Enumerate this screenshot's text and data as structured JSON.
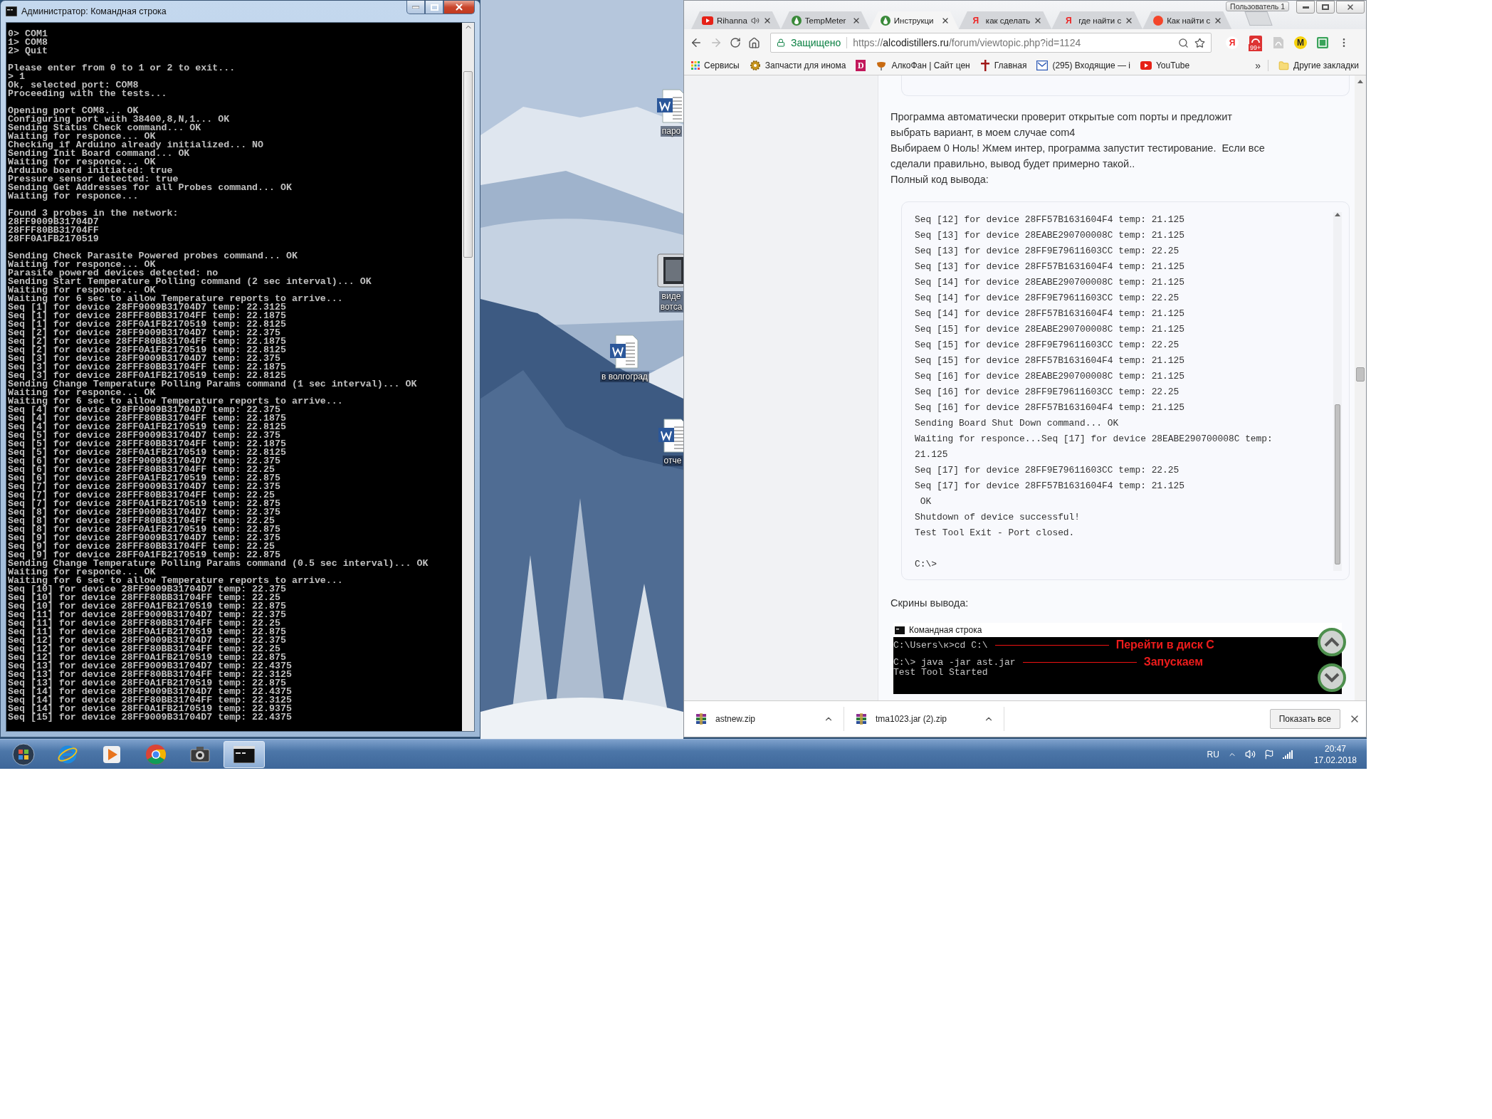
{
  "console_window": {
    "title": "Администратор: Командная строка",
    "blocks": [
      [
        "0> COM1",
        "1> COM8",
        "2> Quit"
      ],
      [
        "Please enter from 0 to 1 or 2 to exit...",
        "> 1",
        "Ok, selected port: COM8",
        "Proceeding with the tests..."
      ],
      [
        "Opening port COM8... OK",
        "Configuring port with 38400,8,N,1... OK",
        "Sending Status Check command... OK",
        "Waiting for responce... OK",
        "Checking if Arduino already initialized... NO",
        "Sending Init Board command... OK",
        "Waiting for responce... OK",
        "Arduino board initiated: true",
        "Pressure sensor detected: true",
        "Sending Get Addresses for all Probes command... OK",
        "Waiting for responce..."
      ],
      [
        "Found 3 probes in the network:",
        "28FF9009B31704D7",
        "28FFF80BB31704FF",
        "28FF0A1FB2170519"
      ],
      [
        "Sending Check Parasite Powered probes command... OK",
        "Waiting for responce... OK",
        "Parasite powered devices detected: no",
        "Sending Start Temperature Polling command (2 sec interval)... OK",
        "Waiting for responce... OK",
        "Waiting for 6 sec to allow Temperature reports to arrive...",
        "Seq [1] for device 28FF9009B31704D7 temp: 22.3125",
        "Seq [1] for device 28FFF80BB31704FF temp: 22.1875",
        "Seq [1] for device 28FF0A1FB2170519 temp: 22.8125",
        "Seq [2] for device 28FF9009B31704D7 temp: 22.375",
        "Seq [2] for device 28FFF80BB31704FF temp: 22.1875",
        "Seq [2] for device 28FF0A1FB2170519 temp: 22.8125",
        "Seq [3] for device 28FF9009B31704D7 temp: 22.375",
        "Seq [3] for device 28FFF80BB31704FF temp: 22.1875",
        "Seq [3] for device 28FF0A1FB2170519 temp: 22.8125",
        "Sending Change Temperature Polling Params command (1 sec interval)... OK",
        "Waiting for responce... OK",
        "Waiting for 6 sec to allow Temperature reports to arrive...",
        "Seq [4] for device 28FF9009B31704D7 temp: 22.375",
        "Seq [4] for device 28FFF80BB31704FF temp: 22.1875",
        "Seq [4] for device 28FF0A1FB2170519 temp: 22.8125",
        "Seq [5] for device 28FF9009B31704D7 temp: 22.375",
        "Seq [5] for device 28FFF80BB31704FF temp: 22.1875",
        "Seq [5] for device 28FF0A1FB2170519 temp: 22.8125",
        "Seq [6] for device 28FF9009B31704D7 temp: 22.375",
        "Seq [6] for device 28FFF80BB31704FF temp: 22.25",
        "Seq [6] for device 28FF0A1FB2170519 temp: 22.875",
        "Seq [7] for device 28FF9009B31704D7 temp: 22.375",
        "Seq [7] for device 28FFF80BB31704FF temp: 22.25",
        "Seq [7] for device 28FF0A1FB2170519 temp: 22.875",
        "Seq [8] for device 28FF9009B31704D7 temp: 22.375",
        "Seq [8] for device 28FFF80BB31704FF temp: 22.25",
        "Seq [8] for device 28FF0A1FB2170519 temp: 22.875",
        "Seq [9] for device 28FF9009B31704D7 temp: 22.375",
        "Seq [9] for device 28FFF80BB31704FF temp: 22.25",
        "Seq [9] for device 28FF0A1FB2170519 temp: 22.875",
        "Sending Change Temperature Polling Params command (0.5 sec interval)... OK",
        "Waiting for responce... OK",
        "Waiting for 6 sec to allow Temperature reports to arrive...",
        "Seq [10] for device 28FF9009B31704D7 temp: 22.375",
        "Seq [10] for device 28FFF80BB31704FF temp: 22.25",
        "Seq [10] for device 28FF0A1FB2170519 temp: 22.875",
        "Seq [11] for device 28FF9009B31704D7 temp: 22.375",
        "Seq [11] for device 28FFF80BB31704FF temp: 22.25",
        "Seq [11] for device 28FF0A1FB2170519 temp: 22.875",
        "Seq [12] for device 28FF9009B31704D7 temp: 22.375",
        "Seq [12] for device 28FFF80BB31704FF temp: 22.25",
        "Seq [12] for device 28FF0A1FB2170519 temp: 22.875",
        "Seq [13] for device 28FF9009B31704D7 temp: 22.4375",
        "Seq [13] for device 28FFF80BB31704FF temp: 22.3125",
        "Seq [13] for device 28FF0A1FB2170519 temp: 22.875",
        "Seq [14] for device 28FF9009B31704D7 temp: 22.4375",
        "Seq [14] for device 28FFF80BB31704FF temp: 22.3125",
        "Seq [14] for device 28FF0A1FB2170519 temp: 22.9375",
        "Seq [15] for device 28FF9009B31704D7 temp: 22.4375"
      ]
    ]
  },
  "desktop": {
    "icons": [
      {
        "kind": "document",
        "label_lines": [
          "паро"
        ]
      },
      {
        "kind": "video",
        "label_lines": [
          "виде",
          "вотса"
        ]
      },
      {
        "kind": "document",
        "label_lines": [
          "в волгоград"
        ]
      },
      {
        "kind": "document",
        "label_lines": [
          "отче"
        ]
      }
    ]
  },
  "browser": {
    "profile_button": "Пользователь 1",
    "tabs": [
      {
        "kind": "play",
        "title": "Rihanna",
        "audio": true,
        "selected": false
      },
      {
        "kind": "drop",
        "title": "TempMeter",
        "audio": false,
        "selected": false
      },
      {
        "kind": "drop",
        "title": "Инструкци",
        "audio": false,
        "selected": true
      },
      {
        "kind": "letter",
        "glyph": "Я",
        "title": "как сделать",
        "audio": false,
        "selected": false
      },
      {
        "kind": "letter",
        "glyph": "Я",
        "title": "где найти с",
        "audio": false,
        "selected": false
      },
      {
        "kind": "dot",
        "title": "Как найти с",
        "audio": false,
        "selected": false
      }
    ],
    "security_label": "Защищено",
    "url": {
      "scheme": "https://",
      "host": "alcodistillers.ru",
      "path": "/forum/viewtopic.php?id=1124"
    },
    "extensions": [
      {
        "kind": "letter",
        "glyph": "Я"
      },
      {
        "kind": "badge",
        "badge": "99+"
      },
      {
        "kind": "file"
      },
      {
        "kind": "coin",
        "glyph": "M"
      },
      {
        "kind": "shield"
      }
    ],
    "bookmarks": [
      {
        "kind": "apps",
        "label": "Сервисы"
      },
      {
        "kind": "gear",
        "label": "Запчасти для инома"
      },
      {
        "kind": "tile",
        "glyph": "D"
      },
      {
        "kind": "glass",
        "label": "АлкоФан | Сайт цен"
      },
      {
        "kind": "cross",
        "label": "Главная"
      },
      {
        "kind": "mail",
        "label": "(295) Входящие — i"
      },
      {
        "kind": "play",
        "label": "YouTube"
      }
    ],
    "bookmarks_overflow": "»",
    "other_bookmarks": "Другие закладки",
    "page": {
      "paragraphs": [
        [
          "Программа автоматически проверит открытые com порты и предложит",
          "выбрать вариант, в моем случае com4"
        ],
        [
          "Выбираем 0 Ноль! Жмем интер, программа запустит тестирование.  Если все",
          "сделали правильно, вывод будет примерно такой.."
        ],
        [
          "Полный код вывода:"
        ]
      ],
      "code_blocks": [
        [
          "Seq [12] for device 28FF57B1631604F4 temp: 21.125",
          "Seq [13] for device 28EABE290700008C temp: 21.125",
          "Seq [13] for device 28FF9E79611603CC temp: 22.25",
          "Seq [13] for device 28FF57B1631604F4 temp: 21.125",
          "Seq [14] for device 28EABE290700008C temp: 21.125",
          "Seq [14] for device 28FF9E79611603CC temp: 22.25",
          "Seq [14] for device 28FF57B1631604F4 temp: 21.125",
          "Seq [15] for device 28EABE290700008C temp: 21.125",
          "Seq [15] for device 28FF9E79611603CC temp: 22.25",
          "Seq [15] for device 28FF57B1631604F4 temp: 21.125",
          "Seq [16] for device 28EABE290700008C temp: 21.125",
          "Seq [16] for device 28FF9E79611603CC temp: 22.25",
          "Seq [16] for device 28FF57B1631604F4 temp: 21.125",
          "Sending Board Shut Down command... OK",
          "Waiting for responce...Seq [17] for device 28EABE290700008C temp:",
          "21.125",
          "Seq [17] for device 28FF9E79611603CC temp: 22.25",
          "Seq [17] for device 28FF57B1631604F4 temp: 21.125",
          " OK",
          "Shutdown of device successful!",
          "Test Tool Exit - Port closed."
        ],
        [
          "C:\\>"
        ]
      ],
      "screens_heading": "Скрины вывода:",
      "screenshot": {
        "title": "Командная строка",
        "blocks": [
          [
            {
              "text": "C:\\Users\\к>cd C:\\",
              "note": "Перейти в диск С"
            }
          ],
          [
            {
              "text": "C:\\> java -jar ast.jar",
              "note": "Запускаем"
            },
            {
              "text": "Test Tool Started"
            }
          ]
        ]
      }
    },
    "downloads": [
      {
        "name": "astnew.zip"
      },
      {
        "name": "tma1023.jar (2).zip"
      }
    ],
    "show_all": "Показать все"
  },
  "taskbar": {
    "apps": [
      {
        "kind": "start",
        "selected": false
      },
      {
        "kind": "ie",
        "selected": false
      },
      {
        "kind": "media",
        "selected": false
      },
      {
        "kind": "chrome",
        "selected": false
      },
      {
        "kind": "camera",
        "selected": false
      },
      {
        "kind": "console",
        "selected": true
      }
    ],
    "language": "RU",
    "time": "20:47",
    "date": "17.02.2018"
  }
}
